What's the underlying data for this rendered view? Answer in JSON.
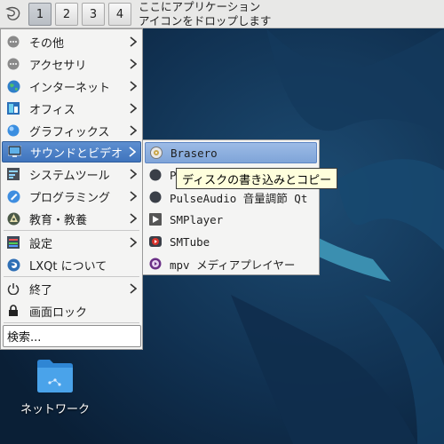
{
  "panel": {
    "workspaces": [
      "1",
      "2",
      "3",
      "4"
    ],
    "active_workspace": "1",
    "drop_hint_line1": "ここにアプリケーション",
    "drop_hint_line2": "アイコンをドロップします"
  },
  "main_menu": {
    "items": [
      {
        "label": "その他",
        "icon": "more-icon",
        "submenu": true
      },
      {
        "label": "アクセサリ",
        "icon": "accessories-icon",
        "submenu": true
      },
      {
        "label": "インターネット",
        "icon": "globe-icon",
        "submenu": true
      },
      {
        "label": "オフィス",
        "icon": "office-icon",
        "submenu": true
      },
      {
        "label": "グラフィックス",
        "icon": "graphics-icon",
        "submenu": true
      },
      {
        "label": "サウンドとビデオ",
        "icon": "multimedia-icon",
        "submenu": true,
        "selected": true
      },
      {
        "label": "システムツール",
        "icon": "system-tools-icon",
        "submenu": true
      },
      {
        "label": "プログラミング",
        "icon": "programming-icon",
        "submenu": true
      },
      {
        "label": "教育・教養",
        "icon": "education-icon",
        "submenu": true
      },
      {
        "label": "設定",
        "icon": "settings-icon",
        "submenu": true
      },
      {
        "label": "LXQt について",
        "icon": "lxqt-icon",
        "submenu": false
      },
      {
        "label": "終了",
        "icon": "power-icon",
        "submenu": true
      },
      {
        "label": "画面ロック",
        "icon": "lock-icon",
        "submenu": false
      }
    ],
    "search_placeholder": "検索..."
  },
  "sub_menu": {
    "items": [
      {
        "label": "Brasero",
        "icon": "brasero-icon",
        "selected": true
      },
      {
        "label": "P",
        "icon": "generic-app-icon"
      },
      {
        "label": "PulseAudio 音量調節 Qt",
        "icon": "pulseaudio-icon"
      },
      {
        "label": "SMPlayer",
        "icon": "smplayer-icon"
      },
      {
        "label": "SMTube",
        "icon": "smtube-icon"
      },
      {
        "label": "mpv メディアプレイヤー",
        "icon": "mpv-icon"
      }
    ]
  },
  "tooltip": {
    "text": "ディスクの書き込みとコピー"
  },
  "desktop": {
    "network_label": "ネットワーク"
  },
  "colors": {
    "highlight": "#4a7fc4",
    "desktop_bg": "#0d2540",
    "tooltip_bg": "#ffffdc"
  }
}
